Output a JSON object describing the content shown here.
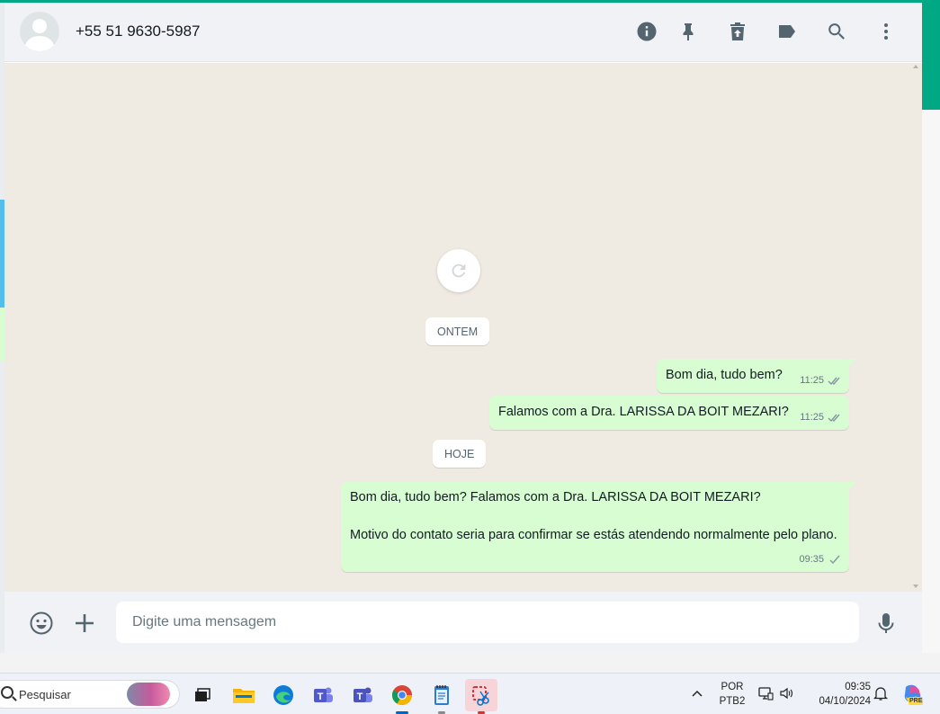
{
  "header": {
    "contact_name": "+55 51 9630-5987",
    "icons": [
      "info-icon",
      "pin-icon",
      "archive-icon",
      "label-icon",
      "search-icon",
      "menu-icon"
    ]
  },
  "chat": {
    "date_yesterday": "ONTEM",
    "date_today": "HOJE",
    "messages": [
      {
        "text": "Bom dia, tudo bem?",
        "time": "11:25",
        "status": "read"
      },
      {
        "text": "Falamos com a Dra. LARISSA DA BOIT MEZARI?",
        "time": "11:25",
        "status": "read"
      },
      {
        "text": "Bom dia, tudo bem? Falamos com a Dra. LARISSA DA BOIT MEZARI?\n\nMotivo do contato seria para confirmar se estás atendendo normalmente pelo plano.",
        "time": "09:35",
        "status": "sent"
      }
    ]
  },
  "composer": {
    "placeholder": "Digite uma mensagem"
  },
  "taskbar": {
    "search_label": "Pesquisar",
    "lang_line1": "POR",
    "lang_line2": "PTB2",
    "time": "09:35",
    "date": "04/10/2024",
    "copilot_badge": "PRE"
  },
  "colors": {
    "accent": "#00a884",
    "outgoing_bubble": "#d9fdd3",
    "chat_bg": "#efeae2",
    "header_bg": "#f0f2f5"
  }
}
